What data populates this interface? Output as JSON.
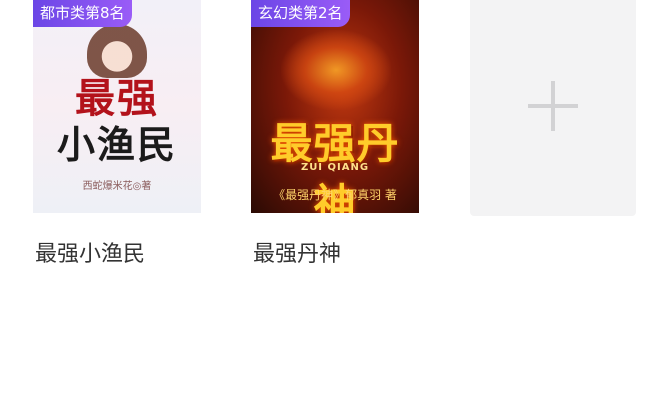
{
  "books": [
    {
      "rank_badge": "都市类第8名",
      "title": "最强小渔民",
      "cover": {
        "title_line1": "最强",
        "title_line2": "小渔民",
        "author": "西蛇爆米花◎著"
      }
    },
    {
      "rank_badge": "玄幻类第2名",
      "title": "最强丹神",
      "cover": {
        "title": "最强丹神",
        "subtitle": "ZUI QIANG",
        "author": "《最强丹神》郁真羽 著"
      }
    }
  ],
  "add_card": {
    "icon": "plus-icon"
  }
}
